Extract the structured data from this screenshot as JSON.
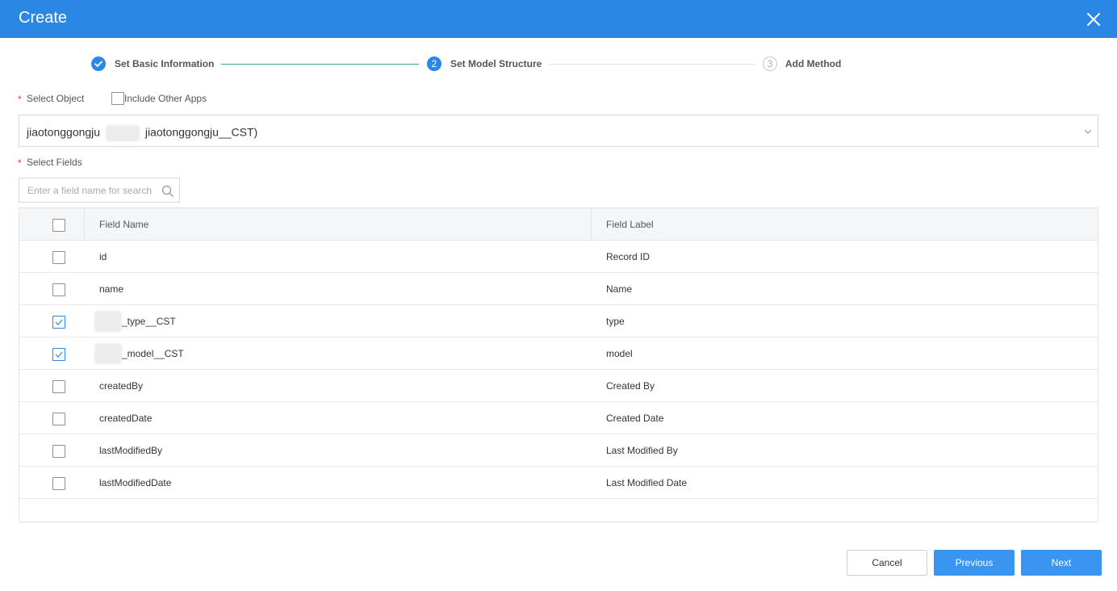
{
  "dialog": {
    "title": "Create"
  },
  "steps": [
    {
      "number": "1",
      "label": "Set Basic Information",
      "state": "done"
    },
    {
      "number": "2",
      "label": "Set Model Structure",
      "state": "active"
    },
    {
      "number": "3",
      "label": "Add Method",
      "state": "pending"
    }
  ],
  "select_object": {
    "label": "Select Object",
    "include_other_apps_label": "Include Other Apps",
    "value_prefix": "jiaotonggongju",
    "value_suffix": "jiaotonggongju__CST)"
  },
  "select_fields": {
    "label": "Select Fields",
    "search_placeholder": "Enter a field name for search"
  },
  "table": {
    "columns": [
      "Field Name",
      "Field Label"
    ],
    "rows": [
      {
        "name": "id",
        "label": "Record ID",
        "checked": false
      },
      {
        "name": "name",
        "label": "Name",
        "checked": false
      },
      {
        "name": "_type__CST",
        "label": "type",
        "checked": true
      },
      {
        "name": "_model__CST",
        "label": "model",
        "checked": true
      },
      {
        "name": "createdBy",
        "label": "Created By",
        "checked": false
      },
      {
        "name": "createdDate",
        "label": "Created Date",
        "checked": false
      },
      {
        "name": "lastModifiedBy",
        "label": "Last Modified By",
        "checked": false
      },
      {
        "name": "lastModifiedDate",
        "label": "Last Modified Date",
        "checked": false
      }
    ]
  },
  "footer": {
    "cancel_label": "Cancel",
    "previous_label": "Previous",
    "next_label": "Next"
  },
  "colors": {
    "primary": "#2a87e4",
    "button_primary": "#3a95f0",
    "step_line_done": "#3aa58f",
    "required": "#e53935"
  }
}
